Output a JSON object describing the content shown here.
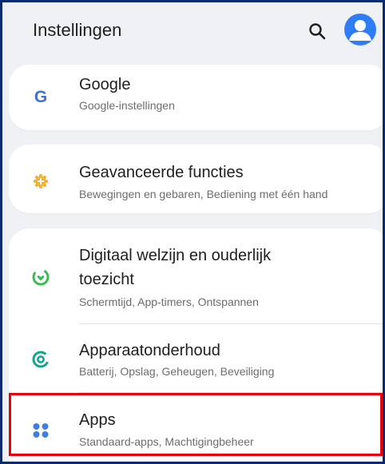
{
  "header": {
    "title": "Instellingen",
    "search_icon": "search-icon",
    "account_icon": "account-icon"
  },
  "items": [
    {
      "label": "Google",
      "sub": "Google-instellingen",
      "icon": "google-icon",
      "icon_color": "#3f6fd6"
    },
    {
      "label": "Geavanceerde functies",
      "sub": "Bewegingen en gebaren, Bediening met één hand",
      "icon": "advanced-features-icon",
      "icon_color": "#f2b13a"
    },
    {
      "label_line1": "Digitaal welzijn en ouderlijk",
      "label_line2": "toezicht",
      "sub": "Schermtijd, App-timers, Ontspannen",
      "icon": "digital-wellbeing-icon",
      "icon_color": "#3cba54"
    },
    {
      "label": "Apparaatonderhoud",
      "sub": "Batterij, Opslag, Geheugen, Beveiliging",
      "icon": "device-care-icon",
      "icon_color": "#12a58f"
    },
    {
      "label": "Apps",
      "sub": "Standaard-apps, Machtigingbeheer",
      "icon": "apps-icon",
      "icon_color": "#3f7fe0"
    }
  ],
  "colors": {
    "accent": "#2f7df6",
    "highlight": "#e8000a",
    "background": "#f0f1f5"
  }
}
